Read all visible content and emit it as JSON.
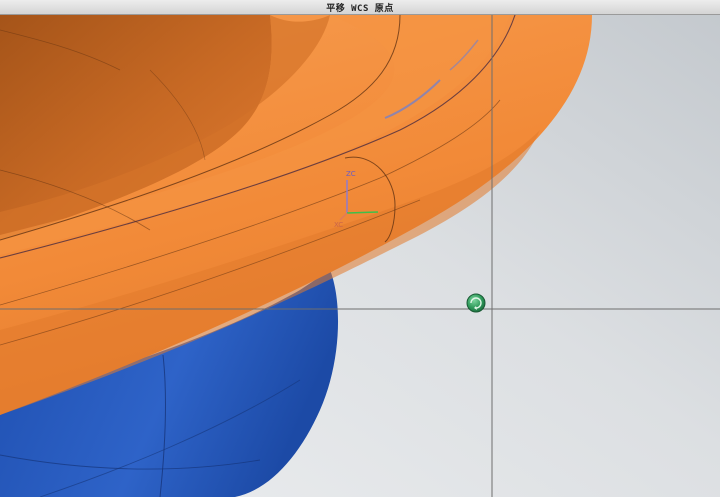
{
  "window": {
    "title": "平移 WCS 原点"
  },
  "wcs": {
    "z_label": "ZC",
    "x_label": "XC"
  },
  "colors": {
    "background_light": "#e9ebed",
    "background_mid": "#c9ced3",
    "ring_orange": "#f08a3a",
    "bowl_blue": "#2a5cc0",
    "crosshair": "#6e6e6e",
    "snap_green": "#2e9a5a",
    "z_axis": "#8a7ad6",
    "y_axis": "#3fbf4a",
    "x_axis": "#e07a5a"
  },
  "icons": {
    "snap_point": "origin-snap-icon"
  }
}
